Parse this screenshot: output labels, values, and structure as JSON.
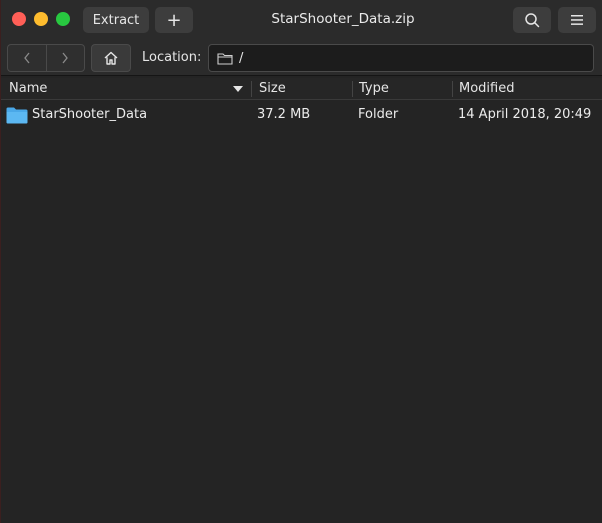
{
  "window": {
    "title": "StarShooter_Data.zip"
  },
  "titlebar": {
    "extract_label": "Extract",
    "add_label": "+",
    "search_icon": "search-icon",
    "menu_icon": "hamburger-menu-icon"
  },
  "toolbar": {
    "back_icon": "chevron-left-icon",
    "forward_icon": "chevron-right-icon",
    "home_icon": "home-icon",
    "location_label": "Location:",
    "location_value": "/"
  },
  "table": {
    "columns": [
      "Name",
      "Size",
      "Type",
      "Modified"
    ],
    "rows": [
      {
        "name": "StarShooter_Data",
        "size": "37.2 MB",
        "type": "Folder",
        "modified": "14 April 2018, 20:49"
      }
    ]
  },
  "colors": {
    "close": "#ff5f57",
    "minimize": "#febc2e",
    "maximize": "#28c840",
    "folder_icon": "#4aa8e8"
  }
}
